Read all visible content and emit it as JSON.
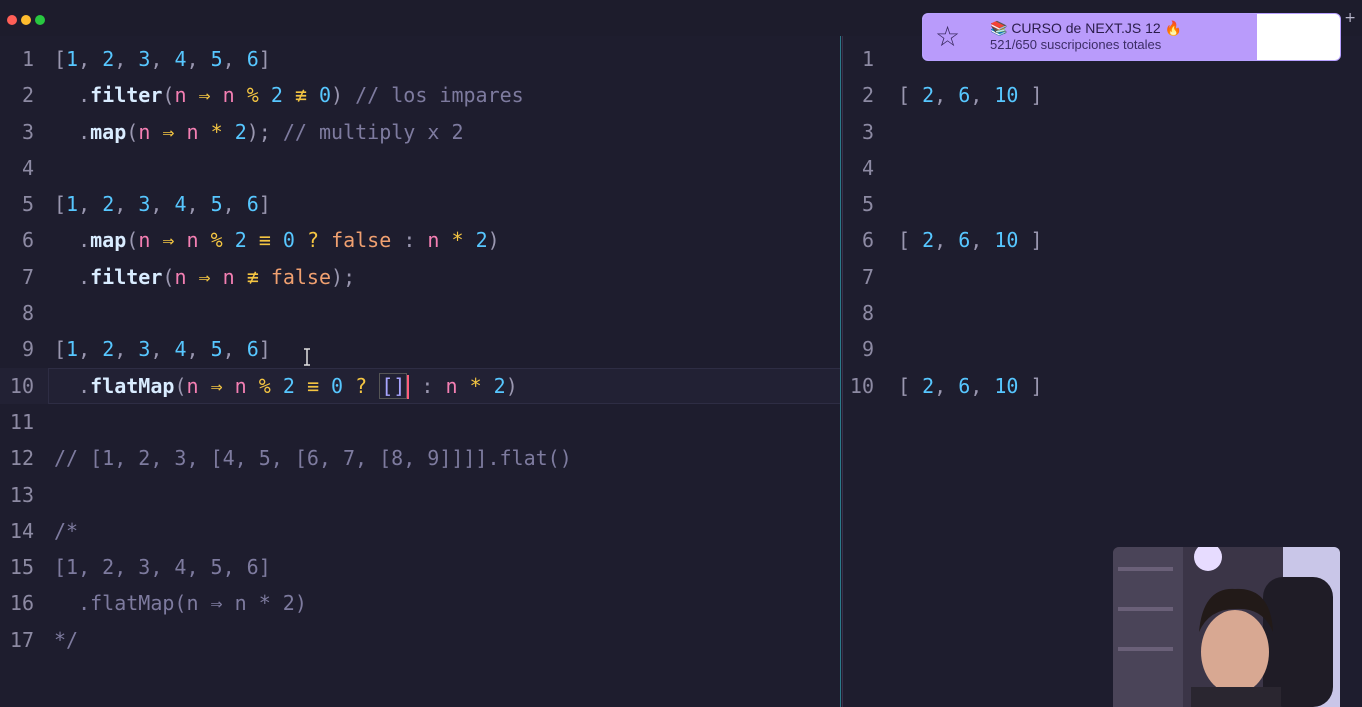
{
  "banner": {
    "title": "📚 CURSO de NEXT.JS 12 🔥",
    "subtitle": "521/650 suscripciones totales",
    "progress_fraction": 0.8
  },
  "editor": {
    "lines": [
      {
        "n": "1",
        "c": "[1, 2, 3, 4, 5, 6]"
      },
      {
        "n": "2",
        "c": "  .filter(n ⇒ n % 2 ≢ 0) // los impares"
      },
      {
        "n": "3",
        "c": "  .map(n ⇒ n * 2); // multiply x 2"
      },
      {
        "n": "4",
        "c": ""
      },
      {
        "n": "5",
        "c": "[1, 2, 3, 4, 5, 6]"
      },
      {
        "n": "6",
        "c": "  .map(n ⇒ n % 2 ≡ 0 ? false : n * 2)"
      },
      {
        "n": "7",
        "c": "  .filter(n ⇒ n ≢ false);"
      },
      {
        "n": "8",
        "c": ""
      },
      {
        "n": "9",
        "c": "[1, 2, 3, 4, 5, 6]"
      },
      {
        "n": "10",
        "c": "  .flatMap(n ⇒ n % 2 ≡ 0 ? [] : n * 2)"
      },
      {
        "n": "11",
        "c": ""
      },
      {
        "n": "12",
        "c": "// [1, 2, 3, [4, 5, [6, 7, [8, 9]]]].flat()"
      },
      {
        "n": "13",
        "c": ""
      },
      {
        "n": "14",
        "c": "/*"
      },
      {
        "n": "15",
        "c": "[1, 2, 3, 4, 5, 6]"
      },
      {
        "n": "16",
        "c": "  .flatMap(n ⇒ n * 2)"
      },
      {
        "n": "17",
        "c": "*/"
      }
    ]
  },
  "output": {
    "lines": [
      {
        "n": "1",
        "c": ""
      },
      {
        "n": "2",
        "c": "[ 2, 6, 10 ]"
      },
      {
        "n": "3",
        "c": ""
      },
      {
        "n": "4",
        "c": ""
      },
      {
        "n": "5",
        "c": ""
      },
      {
        "n": "6",
        "c": "[ 2, 6, 10 ]"
      },
      {
        "n": "7",
        "c": ""
      },
      {
        "n": "8",
        "c": ""
      },
      {
        "n": "9",
        "c": ""
      },
      {
        "n": "10",
        "c": "[ 2, 6, 10 ]"
      }
    ]
  },
  "window": {
    "plus_label": "+"
  },
  "colors": {
    "close": "#ff5f57",
    "minimize": "#febc2e",
    "zoom": "#28c840",
    "accent": "#b99bfb"
  }
}
